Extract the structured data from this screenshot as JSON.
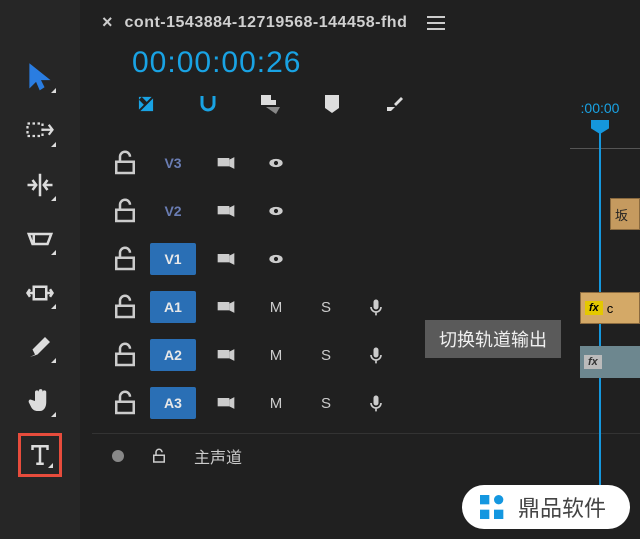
{
  "header": {
    "close": "×",
    "title": "cont-1543884-12719568-144458-fhd"
  },
  "timecode": "00:00:00:26",
  "playhead_label": ":00:00",
  "tracks": {
    "v3": "V3",
    "v2": "V2",
    "v1": "V1",
    "a1": "A1",
    "a2": "A2",
    "a3": "A3",
    "m": "M",
    "s": "S"
  },
  "tooltip": "切换轨道输出",
  "clips": {
    "c1": "坂",
    "c2": "c",
    "fx": "fx"
  },
  "master": {
    "label": "主声道"
  },
  "watermark": "鼎品软件"
}
